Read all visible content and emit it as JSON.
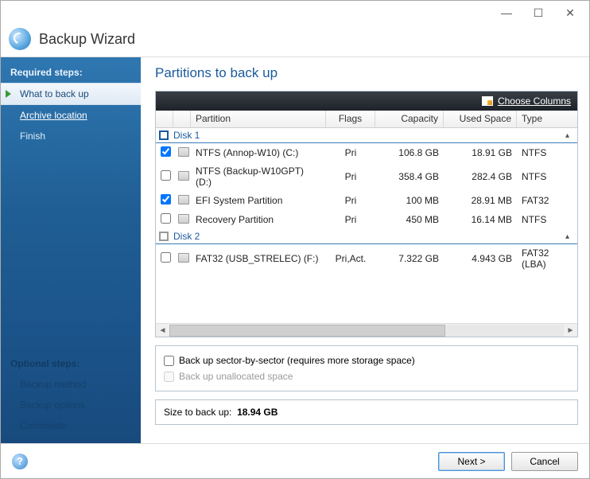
{
  "window": {
    "title": "Backup Wizard"
  },
  "sidebar": {
    "required_title": "Required steps:",
    "items": [
      {
        "label": "What to back up",
        "active": true
      },
      {
        "label": "Archive location",
        "link": true
      },
      {
        "label": "Finish"
      }
    ],
    "optional_title": "Optional steps:",
    "optional": [
      "Backup method",
      "Backup options",
      "Comments"
    ]
  },
  "main": {
    "heading": "Partitions to back up",
    "choose_columns": "Choose Columns",
    "columns": {
      "partition": "Partition",
      "flags": "Flags",
      "capacity": "Capacity",
      "used": "Used Space",
      "type": "Type"
    },
    "disks": [
      {
        "name": "Disk 1",
        "partitions": [
          {
            "checked": true,
            "name": "NTFS (Annop-W10) (C:)",
            "flags": "Pri",
            "capacity": "106.8 GB",
            "used": "18.91 GB",
            "type": "NTFS"
          },
          {
            "checked": false,
            "name": "NTFS (Backup-W10GPT) (D:)",
            "flags": "Pri",
            "capacity": "358.4 GB",
            "used": "282.4 GB",
            "type": "NTFS"
          },
          {
            "checked": true,
            "name": "EFI System Partition",
            "flags": "Pri",
            "capacity": "100 MB",
            "used": "28.91 MB",
            "type": "FAT32"
          },
          {
            "checked": false,
            "name": "Recovery Partition",
            "flags": "Pri",
            "capacity": "450 MB",
            "used": "16.14 MB",
            "type": "NTFS"
          }
        ]
      },
      {
        "name": "Disk 2",
        "partitions": [
          {
            "checked": false,
            "name": "FAT32 (USB_STRELEC) (F:)",
            "flags": "Pri,Act.",
            "capacity": "7.322 GB",
            "used": "4.943 GB",
            "type": "FAT32 (LBA)"
          }
        ]
      }
    ],
    "opt_sector": "Back up sector-by-sector (requires more storage space)",
    "opt_unalloc": "Back up unallocated space",
    "size_label": "Size to back up:",
    "size_value": "18.94 GB"
  },
  "footer": {
    "next": "Next >",
    "cancel": "Cancel"
  }
}
